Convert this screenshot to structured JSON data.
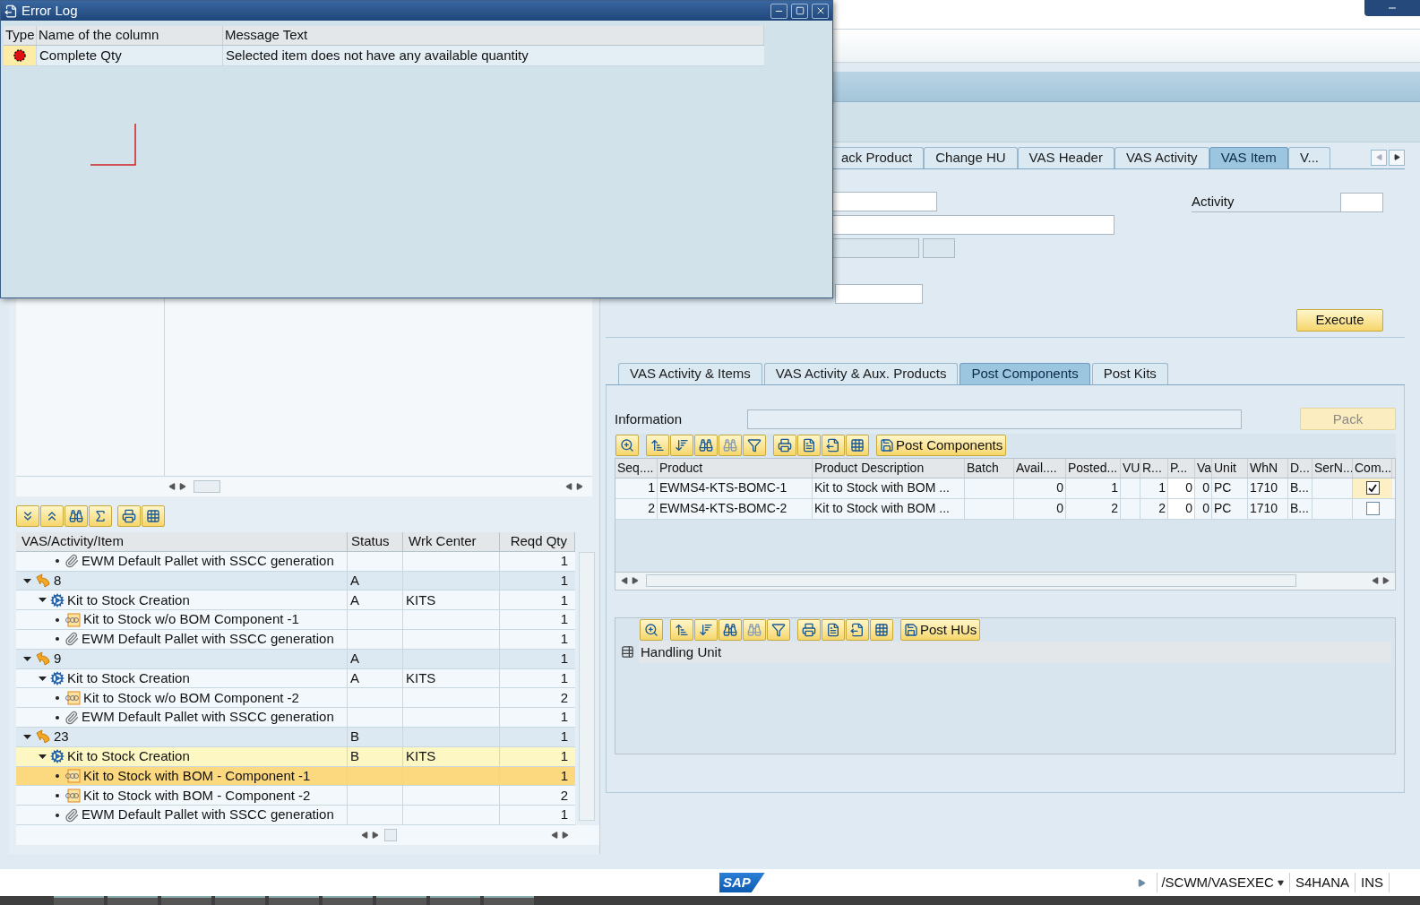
{
  "error_log": {
    "title": "Error Log",
    "columns": [
      "Type",
      "Name of the column",
      "Message Text"
    ],
    "rows": [
      {
        "kind": "error",
        "column": "Complete Qty",
        "message": "Selected item does not have any available quantity"
      }
    ]
  },
  "header_tabs": [
    {
      "label": "ack Product",
      "selected": false
    },
    {
      "label": "Change HU",
      "selected": false
    },
    {
      "label": "VAS Header",
      "selected": false
    },
    {
      "label": "VAS Activity",
      "selected": false
    },
    {
      "label": "VAS Item",
      "selected": true
    },
    {
      "label": "V...",
      "selected": false
    }
  ],
  "activity_label": "Activity",
  "execute_button": "Execute",
  "sub_tabs": [
    {
      "label": "VAS Activity & Items",
      "selected": false
    },
    {
      "label": "VAS Activity & Aux. Products",
      "selected": false
    },
    {
      "label": "Post Components",
      "selected": true
    },
    {
      "label": "Post Kits",
      "selected": false
    }
  ],
  "information_label": "Information",
  "pack_button": {
    "label": "Pack",
    "disabled": true
  },
  "components_toolbar_button": "Post Components",
  "components_table": {
    "columns": [
      "Seq....",
      "Product",
      "Product Description",
      "Batch",
      "Avail....",
      "Posted...",
      "VU",
      "R...",
      "P...",
      "Va",
      "Unit",
      "WhN",
      "D...",
      "SerN...",
      "Com..."
    ],
    "rows": [
      {
        "seq": "1",
        "product": "EWMS4-KTS-BOMC-1",
        "description": "Kit to Stock with BOM ...",
        "avail": "0",
        "posted": "1",
        "r": "1",
        "p": "0",
        "va": "0",
        "unit": "PC",
        "whn": "1710",
        "d": "B...",
        "complete": true
      },
      {
        "seq": "2",
        "product": "EWMS4-KTS-BOMC-2",
        "description": "Kit to Stock with BOM ...",
        "avail": "0",
        "posted": "2",
        "r": "2",
        "p": "0",
        "va": "0",
        "unit": "PC",
        "whn": "1710",
        "d": "B...",
        "complete": false
      }
    ]
  },
  "hu_toolbar_button": "Post HUs",
  "hu_column": "Handling Unit",
  "tree": {
    "columns": [
      "VAS/Activity/Item",
      "Status",
      "Wrk Center",
      "Reqd Qty"
    ],
    "rows": [
      {
        "children": [
          {
            "children": [
              {
                "kind": "pallet",
                "label": "EWM Default Pallet with SSCC generation",
                "qty": "1",
                "selected": false,
                "current": false
              }
            ]
          }
        ]
      },
      {
        "kind": "vas",
        "label": "8",
        "status": "A",
        "qty": "1",
        "expanded": true,
        "selected": false,
        "current": false,
        "children": [
          {
            "kind": "activity",
            "label": "Kit to Stock Creation",
            "status": "A",
            "center": "KITS",
            "qty": "1",
            "expanded": true,
            "selected": false,
            "current": false,
            "children": [
              {
                "kind": "item",
                "label": "Kit to Stock w/o BOM Component -1",
                "qty": "1",
                "selected": false,
                "current": false
              },
              {
                "kind": "pallet",
                "label": "EWM Default Pallet with SSCC generation",
                "qty": "1",
                "selected": false,
                "current": false
              }
            ]
          }
        ]
      },
      {
        "kind": "vas",
        "label": "9",
        "status": "A",
        "qty": "1",
        "expanded": true,
        "selected": false,
        "current": false,
        "children": [
          {
            "kind": "activity",
            "label": "Kit to Stock Creation",
            "status": "A",
            "center": "KITS",
            "qty": "1",
            "expanded": true,
            "selected": false,
            "current": false,
            "children": [
              {
                "kind": "item",
                "label": "Kit to Stock w/o BOM Component -2",
                "qty": "2",
                "selected": false,
                "current": false
              },
              {
                "kind": "pallet",
                "label": "EWM Default Pallet with SSCC generation",
                "qty": "1",
                "selected": false,
                "current": false
              }
            ]
          }
        ]
      },
      {
        "kind": "vas",
        "label": "23",
        "status": "B",
        "qty": "1",
        "expanded": true,
        "selected": false,
        "current": false,
        "children": [
          {
            "kind": "activity",
            "label": "Kit to Stock Creation",
            "status": "B",
            "center": "KITS",
            "qty": "1",
            "expanded": true,
            "selected": false,
            "current": true,
            "children": [
              {
                "kind": "item",
                "label": "Kit to Stock with BOM - Component -1",
                "qty": "1",
                "selected": true,
                "current": false
              },
              {
                "kind": "item",
                "label": "Kit to Stock with BOM - Component -2",
                "qty": "2",
                "selected": false,
                "current": false
              },
              {
                "kind": "pallet",
                "label": "EWM Default Pallet with SSCC generation",
                "qty": "1",
                "selected": false,
                "current": false
              }
            ]
          }
        ]
      }
    ]
  },
  "status_bar": {
    "logo": "SAP",
    "transaction": "/SCWM/VASEXEC",
    "system": "S4HANA",
    "mode": "INS"
  }
}
